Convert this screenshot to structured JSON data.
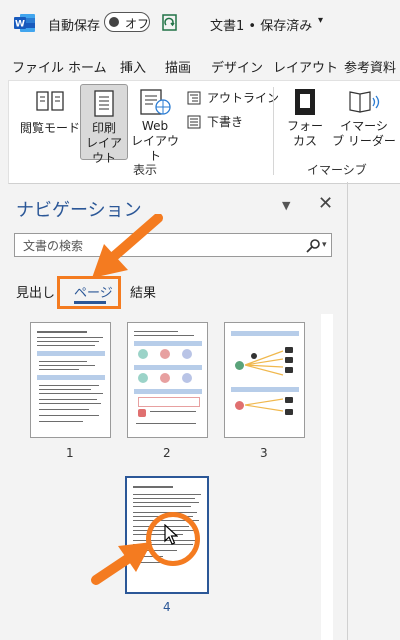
{
  "titlebar": {
    "autosave_label": "自動保存",
    "autosave_state": "オフ",
    "doc_title": "文書1 • 保存済み",
    "doc_title_caret": "▾"
  },
  "menu": [
    "ファイル",
    "ホーム",
    "挿入",
    "描画",
    "デザイン",
    "レイアウト",
    "参考資料"
  ],
  "ribbon": {
    "read_mode": "閲覧モード",
    "print_layout_1": "印刷",
    "print_layout_2": "レイアウト",
    "web_layout_1": "Web",
    "web_layout_2": "レイアウト",
    "outline": "アウトライン",
    "draft": "下書き",
    "focus_1": "フォー",
    "focus_2": "カス",
    "immersive_1": "イマーシ",
    "immersive_2": "ブ リーダー",
    "group_view": "表示",
    "group_immersive": "イマーシブ"
  },
  "navigation": {
    "title": "ナビゲーション",
    "dropdown_glyph": "▼",
    "close_glyph": "✕",
    "search_placeholder": "文書の検索",
    "search_caret": "▾",
    "tabs": {
      "headings": "見出し",
      "pages": "ページ",
      "results": "結果"
    },
    "selected_tab": "pages"
  },
  "pages": [
    "1",
    "2",
    "3",
    "4"
  ],
  "selected_page": "4",
  "colors": {
    "accent": "#2b5797",
    "annotation": "#f47b20"
  }
}
